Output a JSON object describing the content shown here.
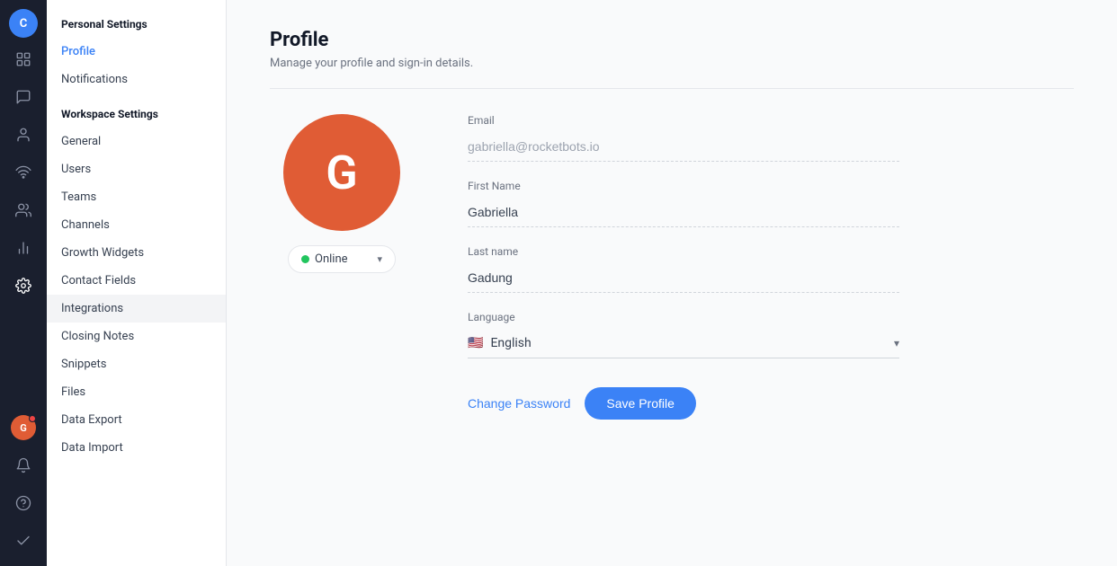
{
  "app": {
    "title": "Personal Settings"
  },
  "iconSidebar": {
    "topAvatar": {
      "letter": "C",
      "color": "#3b82f6"
    },
    "icons": [
      {
        "name": "home-icon",
        "symbol": "⊞",
        "active": false
      },
      {
        "name": "chat-icon",
        "symbol": "💬",
        "active": false
      },
      {
        "name": "contacts-icon",
        "symbol": "👤",
        "active": false
      },
      {
        "name": "signal-icon",
        "symbol": "📶",
        "active": false
      },
      {
        "name": "team-icon",
        "symbol": "⬡",
        "active": false
      },
      {
        "name": "chart-icon",
        "symbol": "📊",
        "active": false
      },
      {
        "name": "settings-icon",
        "symbol": "⚙",
        "active": true
      }
    ],
    "bottomIcons": [
      {
        "name": "user-avatar-icon",
        "letter": "G",
        "color": "#e05c35",
        "hasNotification": true
      },
      {
        "name": "bell-icon",
        "symbol": "🔔"
      },
      {
        "name": "help-icon",
        "symbol": "?"
      },
      {
        "name": "check-icon",
        "symbol": "✔"
      }
    ]
  },
  "navSidebar": {
    "personalTitle": "Personal Settings",
    "personalItems": [
      {
        "label": "Profile",
        "active": true
      },
      {
        "label": "Notifications",
        "active": false
      }
    ],
    "workspaceTitle": "Workspace Settings",
    "workspaceItems": [
      {
        "label": "General"
      },
      {
        "label": "Users"
      },
      {
        "label": "Teams"
      },
      {
        "label": "Channels"
      },
      {
        "label": "Growth Widgets"
      },
      {
        "label": "Contact Fields"
      },
      {
        "label": "Integrations"
      },
      {
        "label": "Closing Notes"
      },
      {
        "label": "Snippets"
      },
      {
        "label": "Files"
      },
      {
        "label": "Data Export"
      },
      {
        "label": "Data Import"
      }
    ]
  },
  "main": {
    "pageTitle": "Profile",
    "pageSubtitle": "Manage your profile and sign-in details.",
    "avatar": {
      "letter": "G",
      "color": "#e05c35"
    },
    "statusDropdown": {
      "status": "Online",
      "dotColor": "#22c55e"
    },
    "form": {
      "emailLabel": "Email",
      "emailValue": "gabriella@rocketbots.io",
      "firstNameLabel": "First Name",
      "firstNameValue": "Gabriella",
      "lastNameLabel": "Last name",
      "lastNameValue": "Gadung",
      "languageLabel": "Language",
      "languageValue": "English",
      "languageFlag": "🇺🇸"
    },
    "actions": {
      "changePassword": "Change Password",
      "saveProfile": "Save Profile"
    }
  }
}
